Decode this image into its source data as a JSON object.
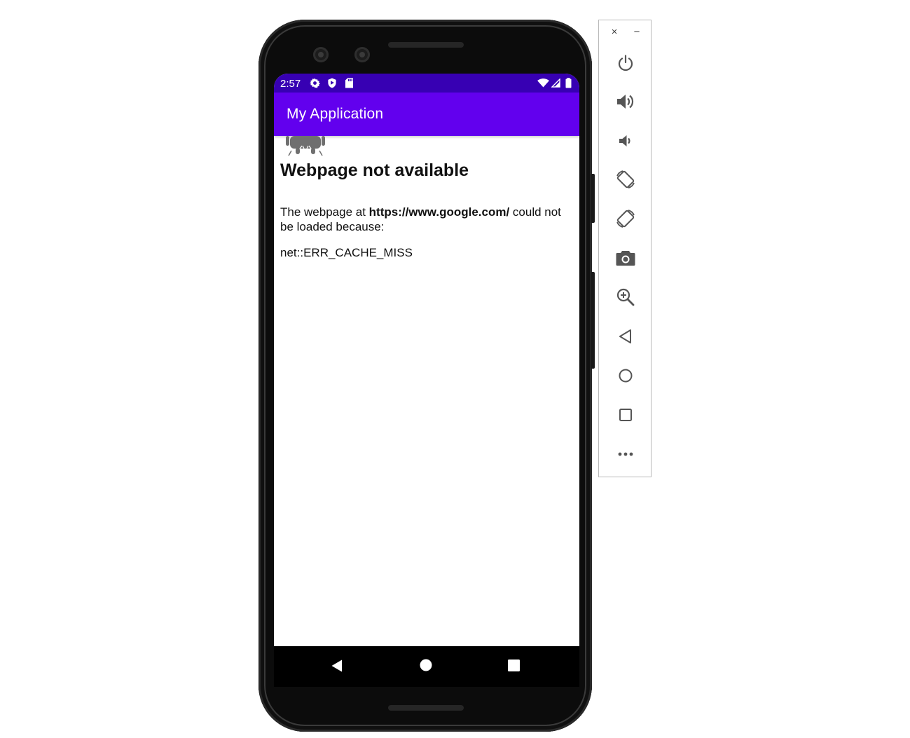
{
  "status_bar": {
    "time": "2:57",
    "left_icons": [
      "gear-icon",
      "shield-icon",
      "sd-card-icon"
    ],
    "right_icons": [
      "wifi-icon",
      "signal-icon",
      "battery-icon"
    ],
    "color": "#3700b3"
  },
  "app_bar": {
    "title": "My Application",
    "color": "#6200ee"
  },
  "webview_error": {
    "icon": "android-robot-icon",
    "heading": "Webpage not available",
    "desc_prefix": "The webpage at ",
    "url": "https://www.google.com/",
    "desc_suffix": " could not be loaded because:",
    "error_code": "net::ERR_CACHE_MISS"
  },
  "nav_bar": {
    "buttons": [
      "back-icon",
      "home-icon",
      "recents-icon"
    ]
  },
  "emulator_toolbar": {
    "close_label": "×",
    "minimize_label": "−",
    "buttons": [
      "power-icon",
      "volume-up-icon",
      "volume-down-icon",
      "rotate-left-icon",
      "rotate-right-icon",
      "camera-icon",
      "zoom-icon",
      "back-icon",
      "home-icon",
      "overview-icon",
      "more-icon"
    ]
  }
}
